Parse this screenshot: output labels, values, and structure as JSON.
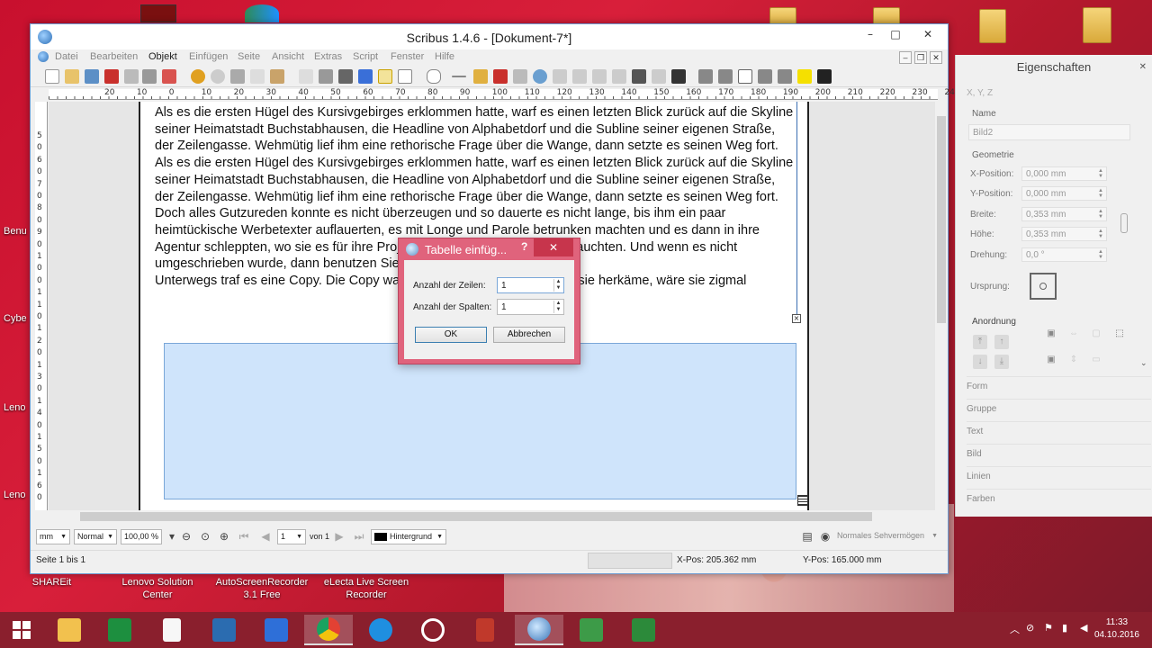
{
  "desktop": {
    "left_labels": [
      "Benu",
      "Cybe",
      "Leno",
      "Leno"
    ],
    "bottom_labels": [
      {
        "line1": "SHAREit",
        "line2": ""
      },
      {
        "line1": "Lenovo Solution",
        "line2": "Center"
      },
      {
        "line1": "AutoScreenRecorder",
        "line2": "3.1 Free"
      },
      {
        "line1": "eLecta Live Screen",
        "line2": "Recorder"
      }
    ]
  },
  "window": {
    "title": "Scribus 1.4.6 - [Dokument-7*]",
    "controls": {
      "minimize": "–",
      "maximize": "□",
      "close": "✕"
    },
    "menu": [
      "Datei",
      "Bearbeiten",
      "Objekt",
      "Einfügen",
      "Seite",
      "Ansicht",
      "Extras",
      "Script",
      "Fenster",
      "Hilfe"
    ],
    "mdi": {
      "minimize": "–",
      "restore": "❐",
      "close": "✕"
    }
  },
  "ruler": {
    "h_ticks": [
      "20",
      "10",
      "0",
      "10",
      "20",
      "30",
      "40",
      "50",
      "60",
      "70",
      "80",
      "90",
      "100",
      "110",
      "120",
      "130",
      "140",
      "150",
      "160",
      "170",
      "180",
      "190",
      "200",
      "210",
      "220",
      "230",
      "240"
    ],
    "v_ticks": [
      "5",
      "0",
      "6",
      "0",
      "7",
      "0",
      "8",
      "0",
      "9",
      "0",
      "1",
      "0",
      "0",
      "1",
      "1",
      "0",
      "1",
      "2",
      "0",
      "1",
      "3",
      "0",
      "1",
      "4",
      "0",
      "1",
      "5",
      "0",
      "1",
      "6",
      "0"
    ]
  },
  "document": {
    "paragraphs": [
      "Als es die ersten Hügel des Kursivgebirges erklommen hatte, warf es einen letzten Blick zurück auf die Skyline seiner Heimatstadt Buchstabhausen, die Headline von Alphabetdorf und die Subline seiner eigenen Straße, der Zeilengasse. Wehmütig lief ihm eine rethorische Frage über die Wange, dann setzte es seinen Weg fort.",
      "Als es die ersten Hügel des Kursivgebirges erklommen hatte, warf es einen letzten Blick zurück auf die Skyline seiner Heimatstadt Buchstabhausen, die Headline von Alphabetdorf und die Subline seiner eigenen Straße, der Zeilengasse. Wehmütig lief ihm eine rethorische Frage über die Wange, dann setzte es seinen Weg fort.",
      "Doch alles Gutzureden konnte es nicht überzeugen und so dauerte es nicht lange, bis ihm ein paar heimtückische Werbetexter auflauerten, es mit Longe und Parole betrunken machten und es dann in ihre Agentur schleppten, wo sie es für ihre Projekte wieder und wieder missbrauchten. Und wenn es nicht umgeschrieben wurde, dann benutzen Sie es immernoch.",
      "Unterwegs traf es eine Copy. Die Copy warnte das Blindtextchen, da, wo sie herkäme, wäre sie zigmal"
    ]
  },
  "dialog": {
    "title": "Tabelle einfüg...",
    "help": "?",
    "close": "✕",
    "rows_label": "Anzahl der Zeilen:",
    "rows_value": "1",
    "cols_label": "Anzahl der Spalten:",
    "cols_value": "1",
    "ok": "OK",
    "cancel": "Abbrechen"
  },
  "statusbar": {
    "unit": "mm",
    "mode": "Normal",
    "zoom": "100,00 %",
    "page": "1",
    "page_of": "von 1",
    "layer": "Hintergrund",
    "vision": "Normales Sehvermögen",
    "page_info": "Seite 1 bis 1",
    "xpos": "X-Pos:  205.362 mm",
    "ypos": "Y-Pos:  165.000 mm"
  },
  "properties": {
    "title": "Eigenschaften",
    "close": "✕",
    "xyz": "X, Y, Z",
    "name_label": "Name",
    "name_value": "Bild2",
    "geometry": "Geometrie",
    "fields": [
      {
        "label": "X-Position:",
        "value": "0,000 mm"
      },
      {
        "label": "Y-Position:",
        "value": "0,000 mm"
      },
      {
        "label": "Breite:",
        "value": "0,353 mm"
      },
      {
        "label": "Höhe:",
        "value": "0,353 mm"
      },
      {
        "label": "Drehung:",
        "value": "0,0 °"
      }
    ],
    "origin": "Ursprung:",
    "arrangement": "Anordnung",
    "sections": [
      "Form",
      "Gruppe",
      "Text",
      "Bild",
      "Linien",
      "Farben"
    ]
  },
  "taskbar": {
    "time": "11:33",
    "date": "04.10.2016",
    "colors": {
      "start": "#ffffff",
      "explorer": "#f2c14e",
      "excel": "#1d8f3f",
      "files": "#f7f7f7",
      "lenovo": "#2b6cb0",
      "m": "#2e6fd8",
      "chrome": "#e34133",
      "ie": "#1f8fe0",
      "circle": "#ffffff",
      "red": "#c0392b",
      "scribus": "#3a76b8",
      "camtasia1": "#3d9b48",
      "camtasia2": "#2c8a3a"
    }
  },
  "colors": {
    "accent": "#3b6fb3",
    "dialog": "#e0637c",
    "imageframe": "#cfe4fb"
  }
}
